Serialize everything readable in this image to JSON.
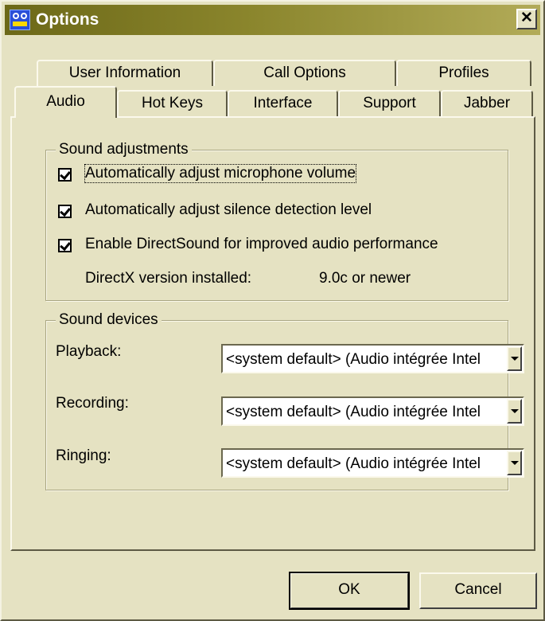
{
  "window": {
    "title": "Options",
    "close_label": "✕"
  },
  "tabs_row1": [
    "User Information",
    "Call Options",
    "Profiles"
  ],
  "tabs_row2": [
    "Audio",
    "Hot Keys",
    "Interface",
    "Support",
    "Jabber"
  ],
  "selected_tab": "Audio",
  "sound_adjustments": {
    "legend": "Sound adjustments",
    "options": [
      {
        "label": "Automatically adjust microphone volume",
        "checked": true
      },
      {
        "label": "Automatically adjust silence detection level",
        "checked": true
      },
      {
        "label": "Enable DirectSound for improved audio performance",
        "checked": true
      }
    ],
    "directx_label": "DirectX version installed:",
    "directx_value": "9.0c or newer"
  },
  "sound_devices": {
    "legend": "Sound devices",
    "playback_label": "Playback:",
    "playback_value": "<system default> (Audio intégrée Intel",
    "recording_label": "Recording:",
    "recording_value": "<system default> (Audio intégrée Intel",
    "ringing_label": "Ringing:",
    "ringing_value": "<system default> (Audio intégrée Intel"
  },
  "buttons": {
    "ok": "OK",
    "cancel": "Cancel"
  }
}
